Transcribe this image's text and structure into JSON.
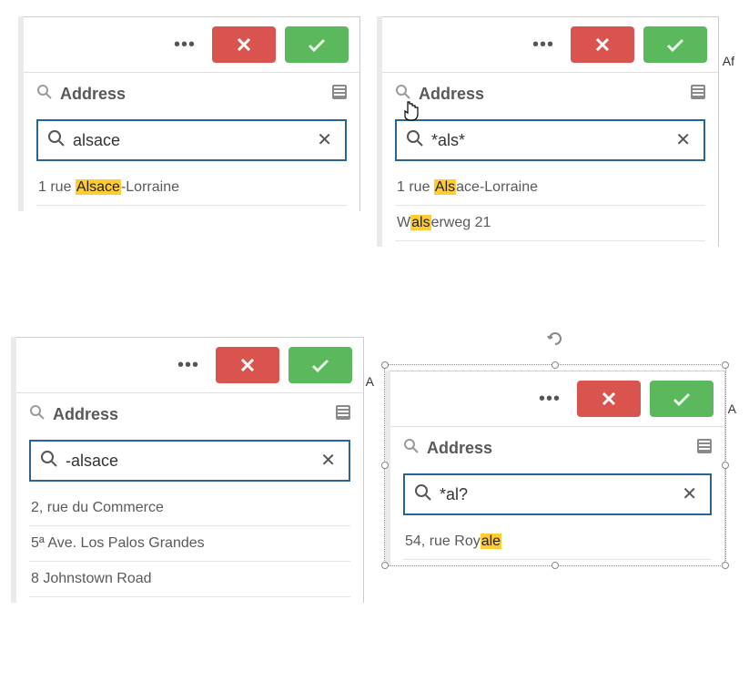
{
  "panels": {
    "p1": {
      "field_label": "Address",
      "search_value": "alsace",
      "results": [
        {
          "pre": "1 rue ",
          "hl": "Alsace",
          "post": "-Lorraine"
        }
      ]
    },
    "p2": {
      "field_label": "Address",
      "search_value": "*als*",
      "edge_text": "Af",
      "results": [
        {
          "pre": "1 rue ",
          "hl": "Als",
          "post": "ace-Lorraine"
        },
        {
          "pre": "W",
          "hl": "als",
          "post": "erweg 21"
        }
      ]
    },
    "p3": {
      "field_label": "Address",
      "search_value": "-alsace",
      "edge_text": "A",
      "results": [
        {
          "pre": "2, rue du Commerce",
          "hl": "",
          "post": ""
        },
        {
          "pre": "5ª Ave. Los Palos Grandes",
          "hl": "",
          "post": ""
        },
        {
          "pre": "8 Johnstown Road",
          "hl": "",
          "post": ""
        }
      ]
    },
    "p4": {
      "field_label": "Address",
      "search_value": "*al?",
      "edge_text": "A",
      "results": [
        {
          "pre": "54, rue Roy",
          "hl": "ale",
          "post": ""
        }
      ]
    }
  }
}
